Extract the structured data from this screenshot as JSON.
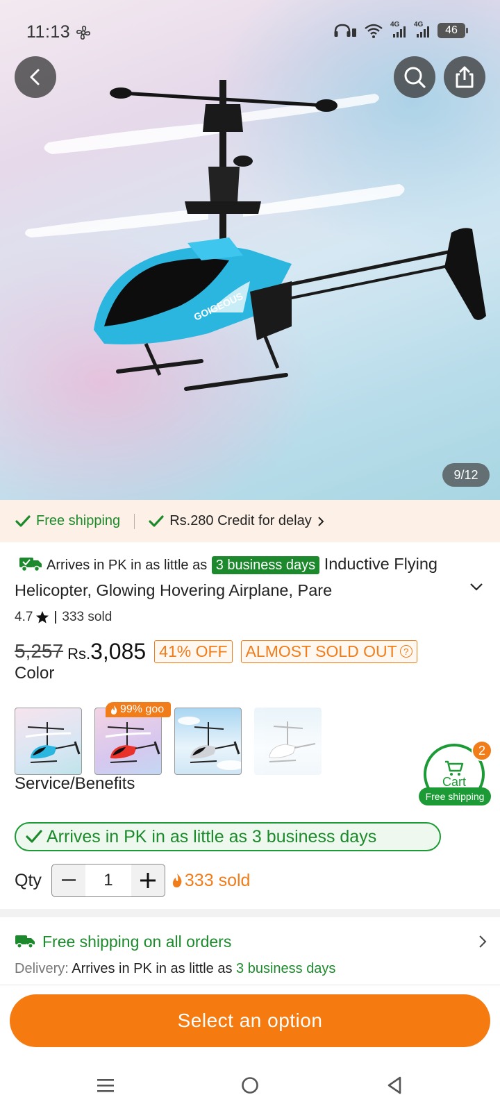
{
  "status_bar": {
    "time": "11:13",
    "network_1": "4G",
    "network_2": "4G",
    "battery": "46"
  },
  "gallery": {
    "counter": "9/12",
    "brand_text": "GOIGEOUS"
  },
  "shipping_strip": {
    "free_shipping": "Free shipping",
    "credit": "Rs.280 Credit for delay"
  },
  "product": {
    "arrives_prefix": "Arrives in PK in as little as",
    "arrives_days": "3 business days",
    "title": "Inductive Flying Helicopter, Glowing Hovering Airplane, Pare",
    "rating": "4.7",
    "sold": "333 sold",
    "old_price": "5,257",
    "currency": "Rs.",
    "price": "3,085",
    "discount": "41% OFF",
    "stock_status": "ALMOST SOLD OUT"
  },
  "color_section": {
    "label": "Color",
    "hot_badge": "99% goo",
    "options": [
      "Blue",
      "Red",
      "Silver",
      "White"
    ]
  },
  "cart": {
    "label": "Cart",
    "count": "2",
    "free_shipping": "Free shipping"
  },
  "service": {
    "label": "Service/Benefits",
    "arrival_pill": "Arrives in PK in as little as 3 business days"
  },
  "quantity": {
    "label": "Qty",
    "value": "1",
    "sold": "333 sold"
  },
  "delivery": {
    "free_shipping_all": "Free shipping on all orders",
    "delivery_label": "Delivery:",
    "delivery_text": "Arrives in PK in as little as",
    "delivery_days": "3 business days"
  },
  "cta": {
    "label": "Select an option"
  },
  "colors": {
    "accent_orange": "#f57a0f",
    "green": "#1c9a35",
    "heli_blue": "#2bb6e0"
  }
}
